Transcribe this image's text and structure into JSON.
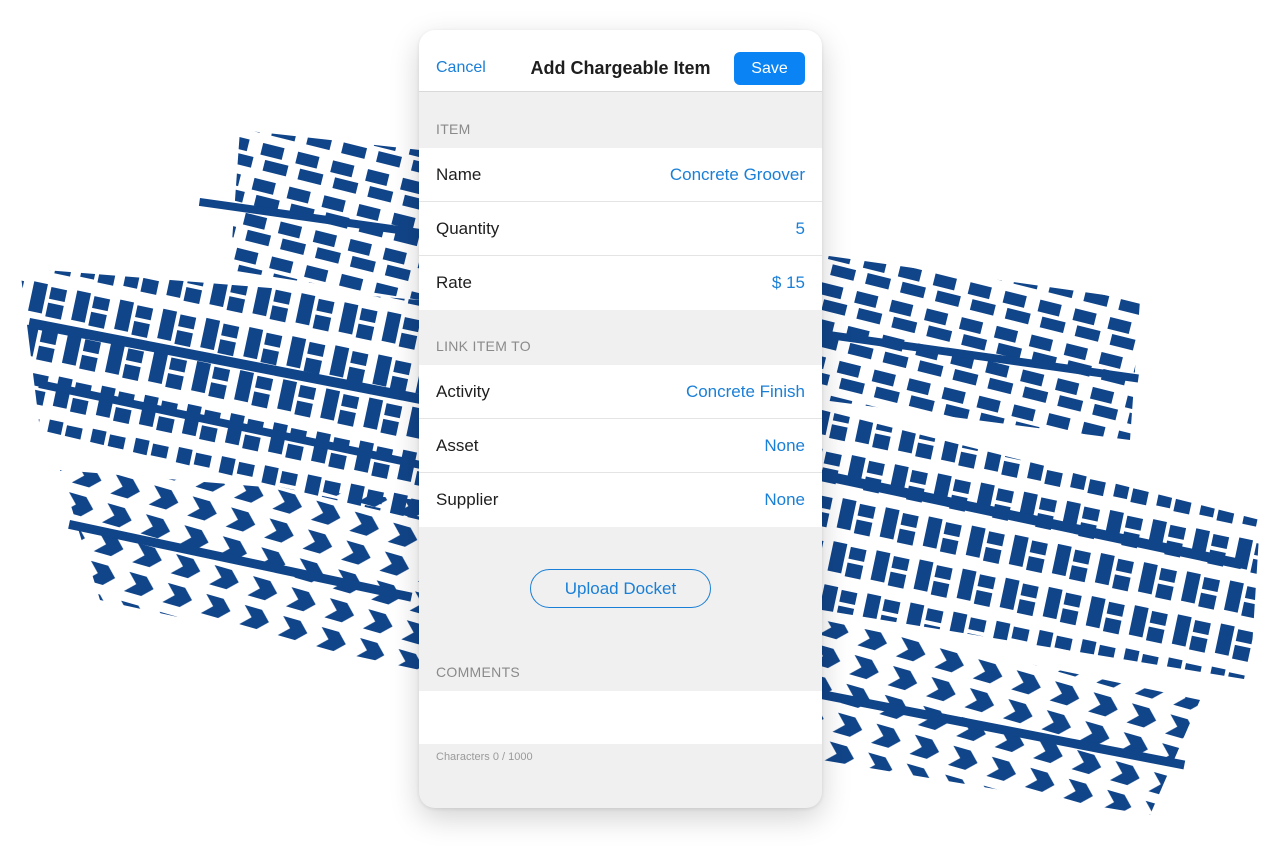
{
  "header": {
    "cancel_label": "Cancel",
    "title": "Add Chargeable Item",
    "save_label": "Save"
  },
  "item_section": {
    "heading": "ITEM",
    "rows": [
      {
        "label": "Name",
        "value": "Concrete Groover"
      },
      {
        "label": "Quantity",
        "value": "5"
      },
      {
        "label": "Rate",
        "value": "$ 15"
      }
    ]
  },
  "link_section": {
    "heading": "LINK ITEM TO",
    "rows": [
      {
        "label": "Activity",
        "value": "Concrete Finish"
      },
      {
        "label": "Asset",
        "value": "None"
      },
      {
        "label": "Supplier",
        "value": "None"
      }
    ]
  },
  "upload_label": "Upload Docket",
  "comments": {
    "heading": "COMMENTS",
    "value": "",
    "counter": "Characters 0 / 1000"
  },
  "colors": {
    "accent": "#0a84f5",
    "link": "#1a7fd6",
    "tread": "#0a3f86"
  },
  "decoration": "tire-tread-marks"
}
